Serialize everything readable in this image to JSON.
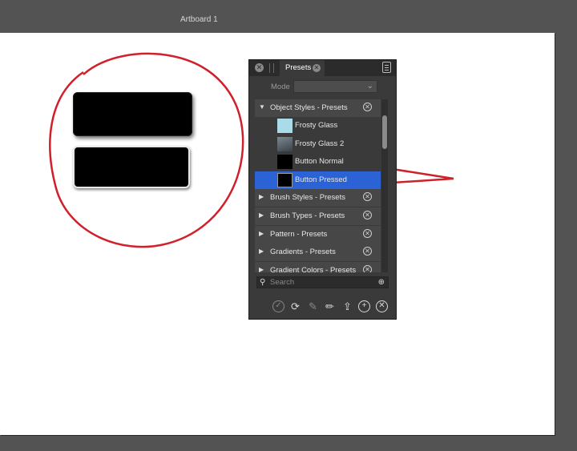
{
  "artboard": {
    "title": "Artboard 1"
  },
  "panel": {
    "tab_label": "Presets",
    "mode_label": "Mode",
    "mode_value": "",
    "groups": [
      {
        "label": "Object Styles - Presets",
        "expanded": true
      },
      {
        "label": "Brush Styles - Presets",
        "expanded": false
      },
      {
        "label": "Brush Types - Presets",
        "expanded": false
      },
      {
        "label": "Pattern - Presets",
        "expanded": false
      },
      {
        "label": "Gradients - Presets",
        "expanded": false
      },
      {
        "label": "Gradient Colors - Presets",
        "expanded": false
      }
    ],
    "items": [
      {
        "label": "Frosty Glass",
        "thumb_color": "#a9dbe8"
      },
      {
        "label": "Frosty Glass 2",
        "thumb_color": "#5f6a74"
      },
      {
        "label": "Button Normal",
        "thumb_color": "#000000"
      },
      {
        "label": "Button Pressed",
        "thumb_color": "#000000",
        "selected": true
      }
    ],
    "search_placeholder": "Search",
    "toolbar": [
      "checkmark-icon",
      "refresh-icon",
      "edit-icon",
      "pen-icon",
      "export-icon",
      "add-icon",
      "delete-icon"
    ]
  },
  "colors": {
    "selection": "#2b63d6",
    "annotation": "#d0202a",
    "panel_bg": "#3a3a3a"
  }
}
